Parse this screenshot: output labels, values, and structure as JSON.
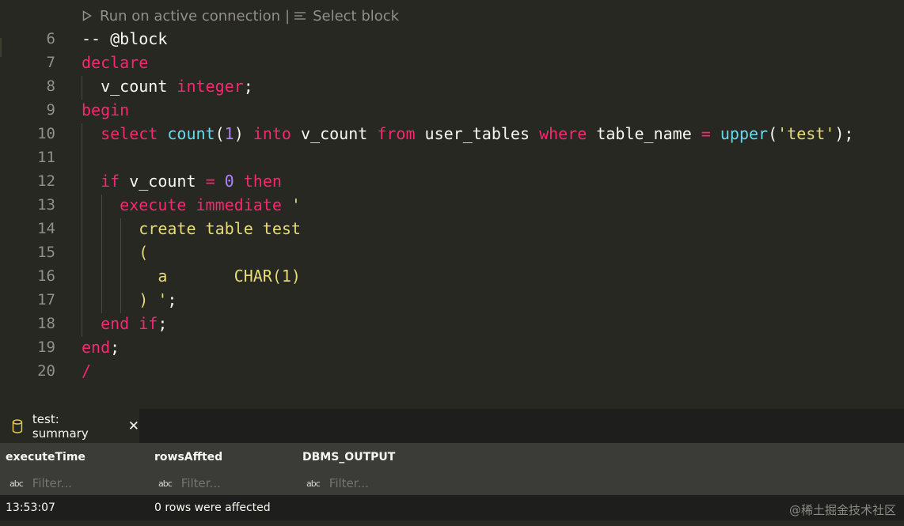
{
  "codelens": {
    "run_label": "Run on active connection",
    "separator": "|",
    "select_label": "Select block"
  },
  "lines": [
    {
      "num": "6",
      "tokens": [
        {
          "t": "-- @block",
          "c": "plain"
        }
      ]
    },
    {
      "num": "7",
      "tokens": [
        {
          "t": "declare",
          "c": "kw"
        }
      ]
    },
    {
      "num": "8",
      "tokens": [
        {
          "t": "  v_count ",
          "c": "plain"
        },
        {
          "t": "integer",
          "c": "kw"
        },
        {
          "t": ";",
          "c": "plain"
        }
      ]
    },
    {
      "num": "9",
      "tokens": [
        {
          "t": "begin",
          "c": "kw"
        }
      ]
    },
    {
      "num": "10",
      "tokens": [
        {
          "t": "  ",
          "c": "plain"
        },
        {
          "t": "select",
          "c": "kw"
        },
        {
          "t": " ",
          "c": "plain"
        },
        {
          "t": "count",
          "c": "fn"
        },
        {
          "t": "(",
          "c": "plain"
        },
        {
          "t": "1",
          "c": "num"
        },
        {
          "t": ") ",
          "c": "plain"
        },
        {
          "t": "into",
          "c": "kw"
        },
        {
          "t": " v_count ",
          "c": "plain"
        },
        {
          "t": "from",
          "c": "kw"
        },
        {
          "t": " user_tables ",
          "c": "plain"
        },
        {
          "t": "where",
          "c": "kw"
        },
        {
          "t": " table_name ",
          "c": "plain"
        },
        {
          "t": "=",
          "c": "kw"
        },
        {
          "t": " ",
          "c": "plain"
        },
        {
          "t": "upper",
          "c": "fn"
        },
        {
          "t": "(",
          "c": "plain"
        },
        {
          "t": "'test'",
          "c": "str"
        },
        {
          "t": ");",
          "c": "plain"
        }
      ]
    },
    {
      "num": "11",
      "tokens": []
    },
    {
      "num": "12",
      "tokens": [
        {
          "t": "  ",
          "c": "plain"
        },
        {
          "t": "if",
          "c": "kw"
        },
        {
          "t": " v_count ",
          "c": "plain"
        },
        {
          "t": "=",
          "c": "kw"
        },
        {
          "t": " ",
          "c": "plain"
        },
        {
          "t": "0",
          "c": "num"
        },
        {
          "t": " ",
          "c": "plain"
        },
        {
          "t": "then",
          "c": "kw"
        }
      ]
    },
    {
      "num": "13",
      "tokens": [
        {
          "t": "    ",
          "c": "plain"
        },
        {
          "t": "execute immediate",
          "c": "kw"
        },
        {
          "t": " ",
          "c": "plain"
        },
        {
          "t": "'",
          "c": "str"
        }
      ]
    },
    {
      "num": "14",
      "tokens": [
        {
          "t": "      create table test",
          "c": "str"
        }
      ]
    },
    {
      "num": "15",
      "tokens": [
        {
          "t": "      (",
          "c": "str"
        }
      ]
    },
    {
      "num": "16",
      "tokens": [
        {
          "t": "        a       CHAR(1)",
          "c": "str"
        }
      ]
    },
    {
      "num": "17",
      "tokens": [
        {
          "t": "      ) '",
          "c": "str"
        },
        {
          "t": ";",
          "c": "plain"
        }
      ]
    },
    {
      "num": "18",
      "tokens": [
        {
          "t": "  ",
          "c": "plain"
        },
        {
          "t": "end if",
          "c": "kw"
        },
        {
          "t": ";",
          "c": "plain"
        }
      ]
    },
    {
      "num": "19",
      "tokens": [
        {
          "t": "end",
          "c": "kw"
        },
        {
          "t": ";",
          "c": "plain"
        }
      ]
    },
    {
      "num": "20",
      "tokens": [
        {
          "t": "/",
          "c": "kw"
        }
      ]
    }
  ],
  "panel": {
    "tab_label": "test: summary",
    "close_glyph": "✕",
    "columns": [
      "executeTime",
      "rowsAffted",
      "DBMS_OUTPUT"
    ],
    "filter_placeholder": "Filter...",
    "filter_icon_text": "abc",
    "rows": [
      [
        "13:53:07",
        "0 rows were affected",
        ""
      ]
    ]
  },
  "watermark": "@稀土掘金技术社区",
  "colors": {
    "keyword": "#f92672",
    "function": "#66d9ef",
    "number": "#ae81ff",
    "string": "#e6db74",
    "text": "#f8f8f2",
    "background": "#272822"
  }
}
